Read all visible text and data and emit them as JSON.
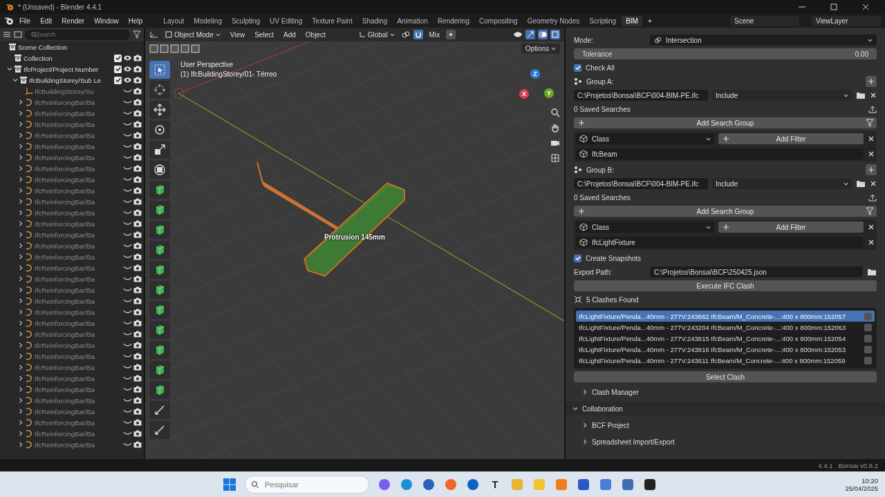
{
  "window": {
    "title": "* (Unsaved) - Blender 4.4.1"
  },
  "menu_bar": {
    "menus": [
      "File",
      "Edit",
      "Render",
      "Window",
      "Help"
    ],
    "workspaces": [
      {
        "label": "Layout",
        "selected": false
      },
      {
        "label": "Modeling",
        "selected": false
      },
      {
        "label": "Sculpting",
        "selected": false
      },
      {
        "label": "UV Editing",
        "selected": false
      },
      {
        "label": "Texture Paint",
        "selected": false
      },
      {
        "label": "Shading",
        "selected": false
      },
      {
        "label": "Animation",
        "selected": false
      },
      {
        "label": "Rendering",
        "selected": false
      },
      {
        "label": "Compositing",
        "selected": false
      },
      {
        "label": "Geometry Nodes",
        "selected": false
      },
      {
        "label": "Scripting",
        "selected": false
      },
      {
        "label": "BIM",
        "selected": true
      }
    ],
    "add_tab": "+",
    "scene": "Scene",
    "view_layer": "ViewLayer"
  },
  "outliner": {
    "search": {
      "placeholder": "Search"
    },
    "items": [
      {
        "label": "Scene Collection",
        "kind": "scene",
        "children": [
          {
            "label": "Collection",
            "kind": "collection",
            "checked": true,
            "visible": true
          },
          {
            "label": "IfcProject/Project Number",
            "kind": "collection",
            "expanded": true,
            "checked": true,
            "visible": true,
            "children": [
              {
                "label": "IfcBuildingStorey/Sub Le",
                "kind": "collection",
                "expanded": true,
                "checked": true,
                "visible": true,
                "children": [
                  {
                    "label": "IfcBuildingStorey/Su",
                    "kind": "empty",
                    "visible": false
                  },
                  {
                    "label": "IfcReinforcingBar/Ba",
                    "kind": "bar",
                    "expanded": false,
                    "visible": false
                  },
                  {
                    "label": "IfcReinforcingBar/Ba",
                    "kind": "bar",
                    "expanded": false,
                    "visible": false
                  },
                  {
                    "label": "IfcReinforcingBar/Ba",
                    "kind": "bar",
                    "expanded": false,
                    "visible": false
                  },
                  {
                    "label": "IfcReinforcingBar/Ba",
                    "kind": "bar",
                    "expanded": false,
                    "visible": false
                  },
                  {
                    "label": "IfcReinforcingBar/Ba",
                    "kind": "bar",
                    "expanded": false,
                    "visible": false
                  },
                  {
                    "label": "IfcReinforcingBar/Ba",
                    "kind": "bar",
                    "expanded": false,
                    "visible": false
                  },
                  {
                    "label": "IfcReinforcingBar/Ba",
                    "kind": "bar",
                    "expanded": false,
                    "visible": false
                  },
                  {
                    "label": "IfcReinforcingBar/Ba",
                    "kind": "bar",
                    "expanded": false,
                    "visible": false
                  },
                  {
                    "label": "IfcReinforcingBar/Ba",
                    "kind": "bar",
                    "expanded": false,
                    "visible": false
                  },
                  {
                    "label": "IfcReinforcingBar/Ba",
                    "kind": "bar",
                    "expanded": false,
                    "visible": false
                  },
                  {
                    "label": "IfcReinforcingBar/Ba",
                    "kind": "bar",
                    "expanded": false,
                    "visible": false
                  },
                  {
                    "label": "IfcReinforcingBar/Ba",
                    "kind": "bar",
                    "expanded": false,
                    "visible": false
                  },
                  {
                    "label": "IfcReinforcingBar/Ba",
                    "kind": "bar",
                    "expanded": false,
                    "visible": false
                  },
                  {
                    "label": "IfcReinforcingBar/Ba",
                    "kind": "bar",
                    "expanded": false,
                    "visible": false
                  },
                  {
                    "label": "IfcReinforcingBar/Ba",
                    "kind": "bar",
                    "expanded": false,
                    "visible": false
                  },
                  {
                    "label": "IfcReinforcingBar/Ba",
                    "kind": "bar",
                    "expanded": false,
                    "visible": false
                  },
                  {
                    "label": "IfcReinforcingBar/Ba",
                    "kind": "bar",
                    "expanded": false,
                    "visible": false
                  },
                  {
                    "label": "IfcReinforcingBar/Ba",
                    "kind": "bar",
                    "expanded": false,
                    "visible": false
                  },
                  {
                    "label": "IfcReinforcingBar/Ba",
                    "kind": "bar",
                    "expanded": false,
                    "visible": false
                  },
                  {
                    "label": "IfcReinforcingBar/Ba",
                    "kind": "bar",
                    "expanded": false,
                    "visible": false
                  },
                  {
                    "label": "IfcReinforcingBar/Ba",
                    "kind": "bar",
                    "expanded": false,
                    "visible": false
                  },
                  {
                    "label": "IfcReinforcingBar/Ba",
                    "kind": "bar",
                    "expanded": false,
                    "visible": false
                  },
                  {
                    "label": "IfcReinforcingBar/Ba",
                    "kind": "bar",
                    "expanded": false,
                    "visible": false
                  },
                  {
                    "label": "IfcReinforcingBar/Ba",
                    "kind": "bar",
                    "expanded": false,
                    "visible": false
                  },
                  {
                    "label": "IfcReinforcingBar/Ba",
                    "kind": "bar",
                    "expanded": false,
                    "visible": false
                  },
                  {
                    "label": "IfcReinforcingBar/Ba",
                    "kind": "bar",
                    "expanded": false,
                    "visible": false
                  },
                  {
                    "label": "IfcReinforcingBar/Ba",
                    "kind": "bar",
                    "expanded": false,
                    "visible": false
                  },
                  {
                    "label": "IfcReinforcingBar/Ba",
                    "kind": "bar",
                    "expanded": false,
                    "visible": false
                  },
                  {
                    "label": "IfcReinforcingBar/Ba",
                    "kind": "bar",
                    "expanded": false,
                    "visible": false
                  },
                  {
                    "label": "IfcReinforcingBar/Ba",
                    "kind": "bar",
                    "expanded": false,
                    "visible": false
                  },
                  {
                    "label": "IfcReinforcingBar/Ba",
                    "kind": "bar",
                    "expanded": false,
                    "visible": false
                  },
                  {
                    "label": "IfcReinforcingBar/Ba",
                    "kind": "bar",
                    "expanded": false,
                    "visible": false
                  }
                ]
              }
            ]
          }
        ]
      }
    ]
  },
  "viewport": {
    "mode": "Object Mode",
    "menus": [
      "View",
      "Select",
      "Add",
      "Object"
    ],
    "orientation": "Global",
    "snap_target": "Mix",
    "options": "Options",
    "view_name": "User Perspective",
    "active_object": "(1) IfcBuildingStorey/01- Térreo",
    "measure_label": "Protrusion 145mm",
    "gizmo_axes": [
      "Z",
      "Y",
      "X"
    ],
    "tools": [
      {
        "kind": "select",
        "selected": true
      },
      {
        "kind": "cursor",
        "selected": false
      },
      {
        "kind": "move",
        "selected": false
      },
      {
        "kind": "rotate",
        "selected": false
      },
      {
        "kind": "scale",
        "selected": false
      },
      {
        "kind": "transform",
        "selected": false
      },
      {
        "kind": "bim",
        "selected": false
      },
      {
        "kind": "bim",
        "selected": false
      },
      {
        "kind": "bim",
        "selected": false
      },
      {
        "kind": "bim",
        "selected": false
      },
      {
        "kind": "bim",
        "selected": false
      },
      {
        "kind": "bim",
        "selected": false
      },
      {
        "kind": "bim",
        "selected": false
      },
      {
        "kind": "bim",
        "selected": false
      },
      {
        "kind": "bim",
        "selected": false
      },
      {
        "kind": "bim",
        "selected": false
      },
      {
        "kind": "bim",
        "selected": false
      },
      {
        "kind": "measure",
        "selected": false
      },
      {
        "kind": "measure",
        "selected": false
      }
    ]
  },
  "properties": {
    "mode": {
      "label": "Mode:",
      "value": "Intersection"
    },
    "tolerance": {
      "label": "Tolerance",
      "value": "0.00"
    },
    "check_all": {
      "label": "Check All",
      "checked": true
    },
    "groups": [
      {
        "label": "Group A:",
        "file": "C:\\Projetos\\Bonsai\\BCF\\004-BIM-PE.ifc",
        "option": "Include",
        "saved_searches": "0 Saved Searches",
        "add_search_group": "Add Search Group",
        "filter_field": "Class",
        "add_filter": "Add Filter",
        "filter_value": "IfcBeam"
      },
      {
        "label": "Group B:",
        "file": "C:\\Projetos\\Bonsai\\BCF\\004-BIM-PE.ifc",
        "option": "Include",
        "saved_searches": "0 Saved Searches",
        "add_search_group": "Add Search Group",
        "filter_field": "Class",
        "add_filter": "Add Filter",
        "filter_value": "IfcLightFixture"
      }
    ],
    "create_snapshots": {
      "label": "Create Snapshots",
      "checked": true
    },
    "export_path": {
      "label": "Export Path:",
      "value": "C:\\Projetos\\Bonsai\\BCF\\250425.json"
    },
    "execute_button": "Execute IFC Clash",
    "clashes_found": "5 Clashes Found",
    "clashes": [
      {
        "a": "IfcLightFixture/Penda...40mm - 277V:243662",
        "b": "IfcBeam/M_Concrete-...:400 x 800mm:152057",
        "selected": true,
        "checked": false
      },
      {
        "a": "IfcLightFixture/Penda...40mm - 277V:243204",
        "b": "IfcBeam/M_Concrete-...:400 x 800mm:152063",
        "selected": false,
        "checked": false
      },
      {
        "a": "IfcLightFixture/Penda...40mm - 277V:243815",
        "b": "IfcBeam/M_Concrete-...:400 x 800mm:152054",
        "selected": false,
        "checked": false
      },
      {
        "a": "IfcLightFixture/Penda...40mm - 277V:243816",
        "b": "IfcBeam/M_Concrete-...:400 x 800mm:152053",
        "selected": false,
        "checked": false
      },
      {
        "a": "IfcLightFixture/Penda...40mm - 277V:243611",
        "b": "IfcBeam/M_Concrete-...:400 x 800mm:152059",
        "selected": false,
        "checked": false
      }
    ],
    "select_button": "Select Clash",
    "sections": [
      {
        "label": "Clash Manager",
        "expanded": false
      },
      {
        "label": "Collaboration",
        "expanded": true,
        "children": [
          {
            "label": "BCF Project",
            "expanded": false
          },
          {
            "label": "Spreadsheet Import/Export",
            "expanded": false
          }
        ]
      }
    ]
  },
  "status_bar": {
    "version": "4.4.1",
    "addon": "Bonsai v0.8.2"
  },
  "taskbar": {
    "search": {
      "placeholder": "Pesquisar"
    },
    "letter_app": "T",
    "time": "10:20",
    "date": "25/04/2025"
  }
}
